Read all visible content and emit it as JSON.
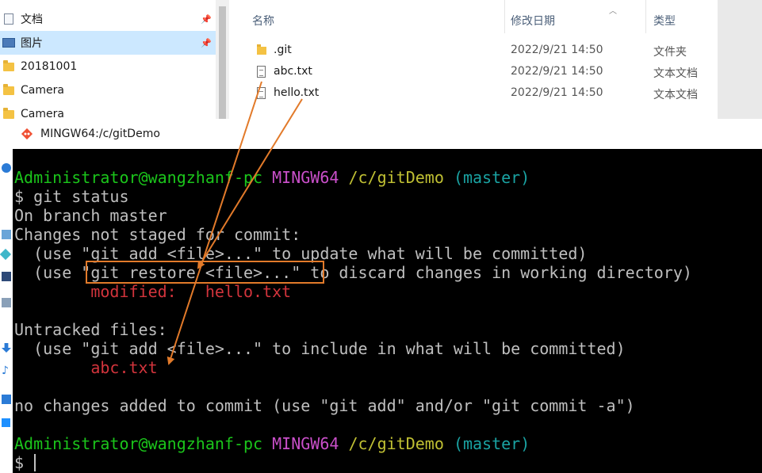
{
  "explorer": {
    "nav_items": [
      {
        "label": "文档",
        "icon": "document-icon",
        "pinned": true
      },
      {
        "label": "图片",
        "icon": "picture-icon",
        "pinned": true,
        "selected": true
      },
      {
        "label": "20181001",
        "icon": "folder-icon"
      },
      {
        "label": "Camera",
        "icon": "folder-icon"
      },
      {
        "label": "Camera",
        "icon": "folder-icon"
      }
    ],
    "columns": {
      "name": "名称",
      "modified": "修改日期",
      "type": "类型"
    },
    "files": [
      {
        "name": ".git",
        "modified": "2022/9/21 14:50",
        "type": "文件夹",
        "icon": "folder-icon"
      },
      {
        "name": "abc.txt",
        "modified": "2022/9/21 14:50",
        "type": "文本文档",
        "icon": "text-file-icon"
      },
      {
        "name": "hello.txt",
        "modified": "2022/9/21 14:50",
        "type": "文本文档",
        "icon": "text-file-icon"
      }
    ]
  },
  "terminal": {
    "title": "MINGW64:/c/gitDemo",
    "prompt": {
      "user": "Administrator@wangzhanf-pc",
      "env": "MINGW64",
      "path": "/c/gitDemo",
      "branch": "(master)"
    },
    "command": "$ git status",
    "lines": {
      "on_branch": "On branch master",
      "changes_header": "Changes not staged for commit:",
      "hint_add": "  (use \"git add <file>...\" to update what will be committed)",
      "hint_restore_prefix": "  (use ",
      "hint_restore_highlight": "\"git restore <file>...\"",
      "hint_restore_suffix": " to discard changes in working directory)",
      "modified": "        modified:   hello.txt",
      "untracked_header": "Untracked files:",
      "hint_include": "  (use \"git add <file>...\" to include in what will be committed)",
      "untracked_file": "        abc.txt",
      "no_changes": "no changes added to commit (use \"git add\" and/or \"git commit -a\")",
      "final_prompt": "$ "
    },
    "colors": {
      "user": "#1bc51b",
      "env": "#c94fc9",
      "path": "#c0c033",
      "branch": "#1aa3a3",
      "status_file": "#d2343c",
      "annotation": "#e27a2a"
    }
  }
}
